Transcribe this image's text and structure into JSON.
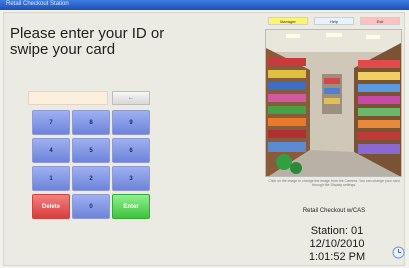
{
  "window": {
    "title": "Retail Checkout Station"
  },
  "prompt": {
    "line1": "Please enter your ID or",
    "line2": "swipe your card"
  },
  "keypad": {
    "backspace_label": "←",
    "keys": [
      "7",
      "8",
      "9",
      "4",
      "5",
      "6",
      "1",
      "2",
      "3"
    ],
    "delete_label": "Delete",
    "zero_label": "0",
    "enter_label": "Enter"
  },
  "tabs": {
    "manager": "Manager",
    "help": "Help",
    "exit": "Exit"
  },
  "camera": {
    "caption": "Click on the image to change the image from the Camera. You can change your card through the Display settings."
  },
  "app": {
    "name": "Retail Checkout w/CAS"
  },
  "status": {
    "station": "Station: 01",
    "date": "12/10/2010",
    "time": "1:01:52 PM"
  },
  "colors": {
    "key_blue": "#7f94e3",
    "delete_red": "#e05050",
    "enter_green": "#4fcc4f"
  },
  "icons": {
    "clock": "clock-icon"
  }
}
